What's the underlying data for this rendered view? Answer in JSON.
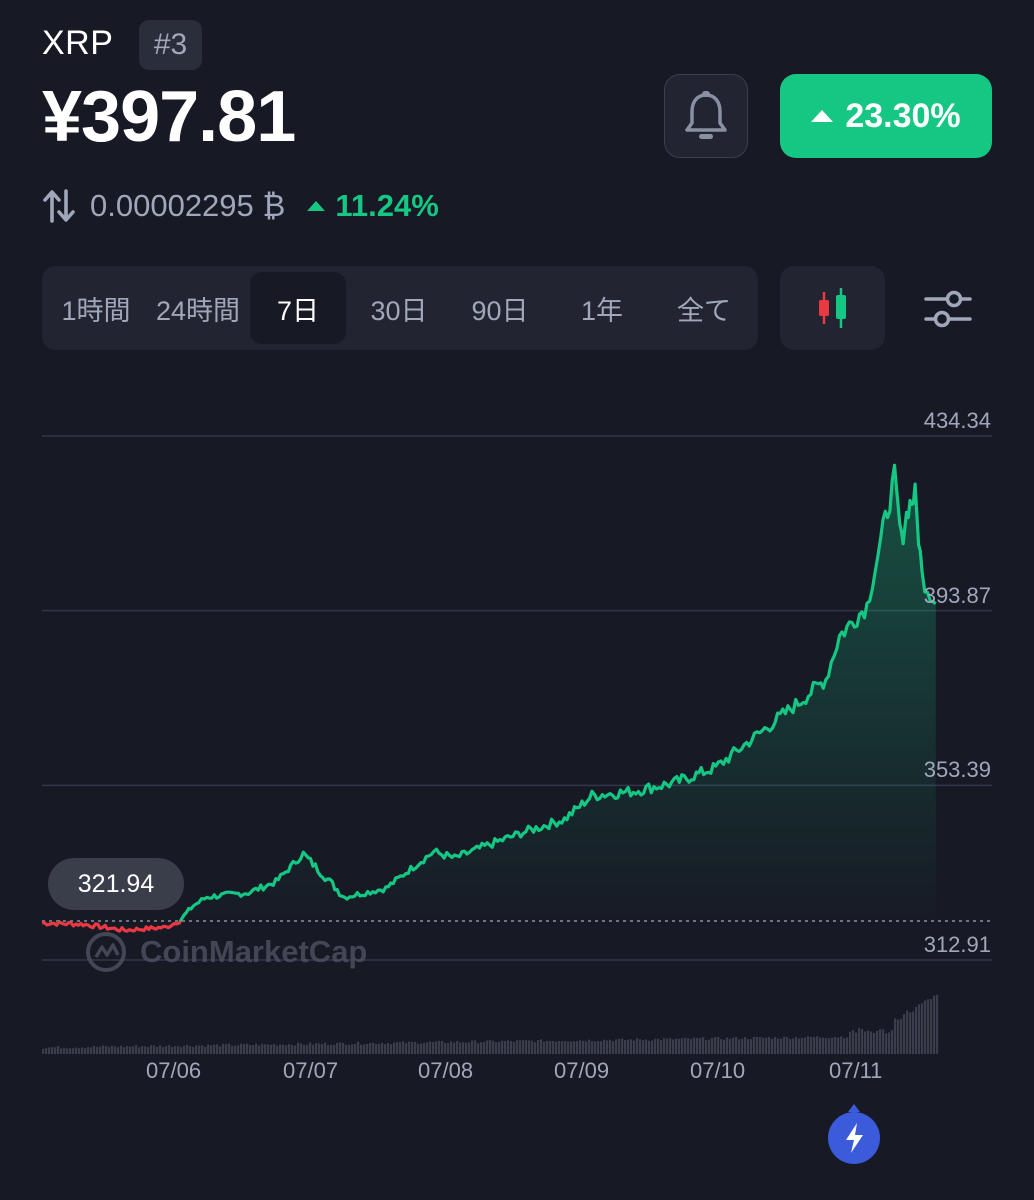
{
  "header": {
    "symbol": "XRP",
    "rank": "#3",
    "price": "¥397.81",
    "change_percent": "23.30%",
    "btc_price": "0.00002295 ₿",
    "btc_change": "11.24%"
  },
  "icons": {
    "bell": "bell-icon",
    "swap": "swap-arrows-icon",
    "candlestick": "candlestick-icon",
    "filter": "filter-sliders-icon",
    "logo": "coinmarketcap-logo-icon",
    "bolt": "lightning-bolt-icon"
  },
  "colors": {
    "background": "#171924",
    "up": "#16c784",
    "down": "#ea3943",
    "panel": "#222531",
    "muted": "#a1a7bb"
  },
  "range_tabs": [
    "1時間",
    "24時間",
    "7日",
    "30日",
    "90日",
    "1年",
    "全て"
  ],
  "selected_range": "7日",
  "watermark": "CoinMarketCap",
  "chart_data": {
    "type": "line",
    "x_tick_labels": [
      "07/06",
      "07/07",
      "07/08",
      "07/09",
      "07/10",
      "07/11"
    ],
    "y_tick_labels": [
      "434.34",
      "393.87",
      "353.39",
      "312.91"
    ],
    "ylim": [
      312.91,
      434.34
    ],
    "reference_value": 321.94,
    "reference_label": "321.94",
    "grid": true,
    "series": [
      {
        "x": [
          0,
          0.3,
          0.6,
          0.9,
          1.0,
          1.1,
          1.2,
          1.5,
          1.7,
          1.9,
          2.2,
          2.5,
          2.7,
          2.85,
          3.0,
          3.2,
          3.5,
          3.8,
          4.0,
          4.3,
          4.6,
          4.9,
          5.2,
          5.5,
          5.7,
          5.8,
          6.0,
          6.1,
          6.2,
          6.25,
          6.3,
          6.35,
          6.4,
          6.5
        ],
        "values": [
          321.5,
          321.2,
          319.8,
          320.5,
          322.0,
          325.5,
          327.5,
          328.5,
          331.0,
          337.5,
          327.5,
          329.5,
          334.5,
          338.0,
          336.5,
          339.0,
          342.5,
          345.5,
          351.0,
          352.0,
          354.0,
          357.5,
          365.0,
          372.5,
          378.0,
          388.0,
          395.0,
          410.0,
          424.5,
          410.0,
          418.0,
          420.5,
          402.0,
          395.5
        ]
      }
    ],
    "volume_trend": "rising"
  }
}
